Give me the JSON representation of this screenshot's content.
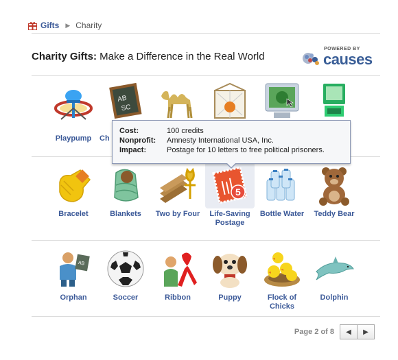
{
  "breadcrumb": {
    "root": "Gifts",
    "current": "Charity"
  },
  "header": {
    "title_bold": "Charity Gifts:",
    "title_rest": " Make a Difference in the Real World",
    "powered_by": "POWERED BY",
    "brand": "causes"
  },
  "rows": [
    [
      {
        "label": "Playpump",
        "icon": "playpump-icon"
      },
      {
        "label": "Ch",
        "icon": "chalkboard-icon"
      },
      {
        "label": "",
        "icon": "camel-icon"
      },
      {
        "label": "",
        "icon": "mosquito-net-icon"
      },
      {
        "label": "",
        "icon": "computer-icon"
      },
      {
        "label": "",
        "icon": "green-computer-icon"
      }
    ],
    [
      {
        "label": "Bracelet",
        "icon": "bracelet-icon"
      },
      {
        "label": "Blankets",
        "icon": "blankets-icon"
      },
      {
        "label": "Two by Four",
        "icon": "lumber-icon"
      },
      {
        "label": "Life-Saving Postage",
        "icon": "postage-stamp-icon"
      },
      {
        "label": "Bottle Water",
        "icon": "water-bottles-icon"
      },
      {
        "label": "Teddy Bear",
        "icon": "teddy-bear-icon"
      }
    ],
    [
      {
        "label": "Orphan",
        "icon": "orphan-icon"
      },
      {
        "label": "Soccer",
        "icon": "soccer-ball-icon"
      },
      {
        "label": "Ribbon",
        "icon": "ribbon-icon"
      },
      {
        "label": "Puppy",
        "icon": "puppy-icon"
      },
      {
        "label": "Flock of Chicks",
        "icon": "chicks-icon"
      },
      {
        "label": "Dolphin",
        "icon": "dolphin-icon"
      }
    ]
  ],
  "tooltip": {
    "cost_label": "Cost:",
    "cost": "100 credits",
    "nonprofit_label": "Nonprofit:",
    "nonprofit": "Amnesty International USA, Inc.",
    "impact_label": "Impact:",
    "impact": "Postage for 10 letters to free political prisoners."
  },
  "pager": {
    "text": "Page 2 of 8",
    "prev": "◀",
    "next": "▶"
  }
}
